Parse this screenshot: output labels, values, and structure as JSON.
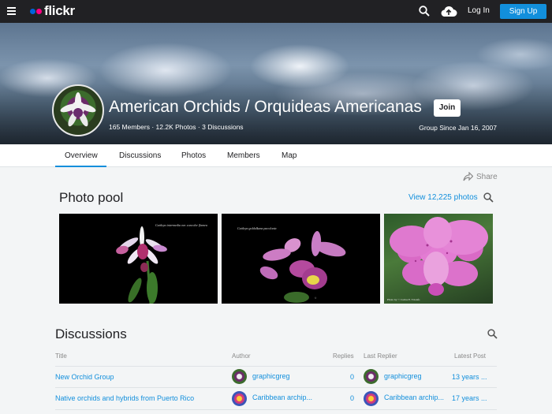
{
  "nav": {
    "logo_text": "flickr",
    "login_label": "Log In",
    "signup_label": "Sign Up"
  },
  "group": {
    "title": "American Orchids / Orquideas Americanas",
    "join_label": "Join",
    "stats": "165 Members · 12.2K Photos · 3 Discussions",
    "since": "Group Since Jan 16, 2007"
  },
  "tabs": [
    {
      "label": "Overview"
    },
    {
      "label": "Discussions"
    },
    {
      "label": "Photos"
    },
    {
      "label": "Members"
    },
    {
      "label": "Map"
    }
  ],
  "share_label": "Share",
  "photo_pool": {
    "title": "Photo pool",
    "view_label": "View 12,225 photos",
    "photos": [
      {
        "caption": "Cattleya intermedia var. concolor flamea"
      },
      {
        "caption": "Cattleya goldulkana pacolonia"
      },
      {
        "caption": "Photo by © Carlos E. Trionfo"
      }
    ]
  },
  "discussions": {
    "title": "Discussions",
    "columns": [
      "Title",
      "Author",
      "Replies",
      "Last Replier",
      "Latest Post"
    ],
    "rows": [
      {
        "title": "New Orchid Group",
        "author": "graphicgreg",
        "replies": "0",
        "last_replier": "graphicgreg",
        "latest_post": "13 years ..."
      },
      {
        "title": "Native orchids and hybrids from Puerto Rico",
        "author": "Caribbean archip...",
        "replies": "0",
        "last_replier": "Caribbean archip...",
        "latest_post": "17 years ..."
      }
    ]
  },
  "colors": {
    "nav_bg": "#212124",
    "accent_blue": "#128fdc",
    "page_bg": "#f3f5f6"
  },
  "icons": [
    "menu-icon",
    "search-icon",
    "upload-cloud-icon",
    "share-icon"
  ]
}
